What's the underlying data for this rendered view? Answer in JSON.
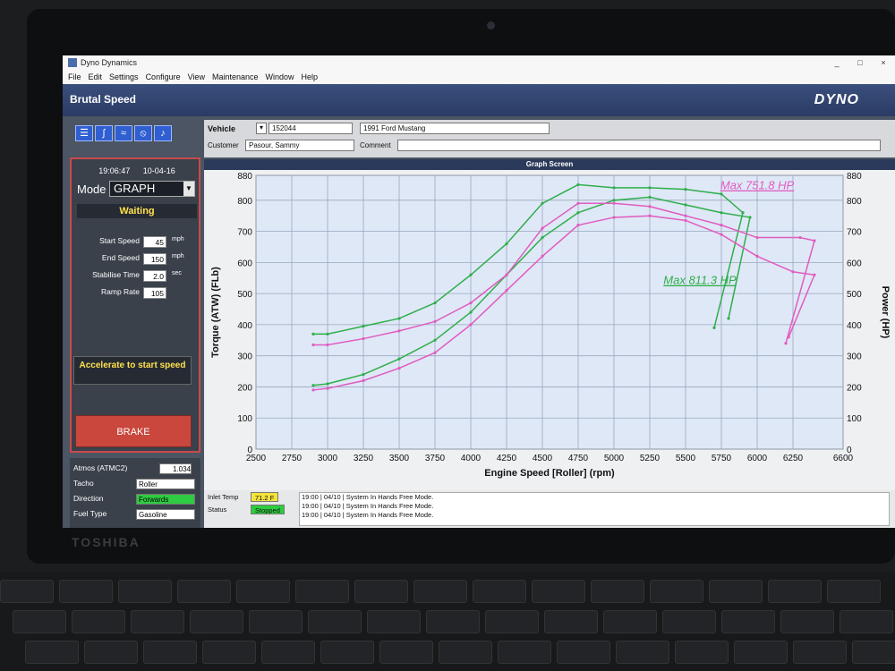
{
  "window": {
    "app_title": "Dyno Dynamics",
    "menu": [
      "File",
      "Edit",
      "Settings",
      "Configure",
      "View",
      "Maintenance",
      "Window",
      "Help"
    ],
    "controls": [
      "_",
      "□",
      "×"
    ]
  },
  "header": {
    "title": "Brutal Speed",
    "logo": "DYNO"
  },
  "toolbar": {
    "icons": [
      "list-icon",
      "curve-icon",
      "wave-icon",
      "no-icon",
      "bell-icon"
    ]
  },
  "vehicle": {
    "vehicle_label": "Vehicle",
    "vehicle_id": "152044",
    "vehicle_name": "1991 Ford Mustang",
    "customer_label": "Customer",
    "customer": "Pasour, Sammy",
    "comment_label": "Comment"
  },
  "left": {
    "time": "19:06:47",
    "date": "10-04-16",
    "mode_label": "Mode",
    "mode_value": "GRAPH",
    "status": "Waiting",
    "params": [
      {
        "label": "Start Speed",
        "value": "45",
        "unit": "mph"
      },
      {
        "label": "End Speed",
        "value": "150",
        "unit": "mph"
      },
      {
        "label": "Stabilise Time",
        "value": "2.0",
        "unit": "sec"
      },
      {
        "label": "Ramp Rate",
        "value": "105",
        "unit": ""
      }
    ],
    "accelerate": "Accelerate to start speed",
    "brake": "BRAKE"
  },
  "settings": {
    "atmos_label": "Atmos (ATMC2)",
    "atmos_value": "1.034",
    "tacho_label": "Tacho",
    "tacho_value": "Roller",
    "direction_label": "Direction",
    "direction_value": "Forwards",
    "fuel_label": "Fuel Type",
    "fuel_value": "Gasoline"
  },
  "graph": {
    "window_title": "Graph Screen"
  },
  "status": {
    "inlet_label": "Inlet Temp",
    "inlet_value": "71.2 F",
    "status_label": "Status",
    "status_value": "Stopped",
    "log": [
      "19:00 | 04/10 | System In Hands Free Mode.",
      "19:00 | 04/10 | System In Hands Free Mode.",
      "19:00 | 04/10 | System In Hands Free Mode."
    ]
  },
  "colors": {
    "green": "#2fae4a",
    "pink": "#e05cc0",
    "plot_bg": "#dfe8f7"
  },
  "chart_data": {
    "type": "line",
    "xlabel": "Engine Speed [Roller] (rpm)",
    "ylabel": "Torque (ATW) (FLb)",
    "y2label": "Power (HP)",
    "xlim": [
      2500,
      6600
    ],
    "ylim": [
      0,
      880
    ],
    "y2lim": [
      0,
      880
    ],
    "xticks": [
      2500,
      2750,
      3000,
      3250,
      3500,
      3750,
      4000,
      4250,
      4500,
      4750,
      5000,
      5250,
      5500,
      5750,
      6000,
      6250,
      6600
    ],
    "yticks": [
      0,
      100,
      200,
      300,
      400,
      500,
      600,
      700,
      800,
      880
    ],
    "y2ticks": [
      0,
      100,
      200,
      300,
      400,
      500,
      600,
      700,
      800,
      880
    ],
    "annotations": [
      {
        "text": "Max 751.8 HP",
        "color": "pink",
        "x": 6000,
        "y": 835
      },
      {
        "text": "Max 811.3 HP",
        "color": "green",
        "x": 5600,
        "y": 530
      }
    ],
    "series": [
      {
        "color": "green",
        "values": [
          [
            2900,
            370
          ],
          [
            3000,
            370
          ],
          [
            3250,
            395
          ],
          [
            3500,
            420
          ],
          [
            3750,
            470
          ],
          [
            4000,
            560
          ],
          [
            4250,
            660
          ],
          [
            4500,
            790
          ],
          [
            4750,
            850
          ],
          [
            5000,
            840
          ],
          [
            5250,
            840
          ],
          [
            5500,
            835
          ],
          [
            5750,
            820
          ],
          [
            5900,
            760
          ],
          [
            5700,
            390
          ]
        ]
      },
      {
        "color": "green",
        "values": [
          [
            2900,
            205
          ],
          [
            3000,
            210
          ],
          [
            3250,
            240
          ],
          [
            3500,
            290
          ],
          [
            3750,
            350
          ],
          [
            4000,
            440
          ],
          [
            4250,
            560
          ],
          [
            4500,
            680
          ],
          [
            4750,
            760
          ],
          [
            5000,
            800
          ],
          [
            5250,
            810
          ],
          [
            5500,
            785
          ],
          [
            5750,
            760
          ],
          [
            5950,
            745
          ],
          [
            5800,
            420
          ]
        ]
      },
      {
        "color": "pink",
        "values": [
          [
            2900,
            335
          ],
          [
            3000,
            335
          ],
          [
            3250,
            355
          ],
          [
            3500,
            380
          ],
          [
            3750,
            410
          ],
          [
            4000,
            470
          ],
          [
            4250,
            560
          ],
          [
            4500,
            710
          ],
          [
            4750,
            790
          ],
          [
            5000,
            790
          ],
          [
            5250,
            780
          ],
          [
            5500,
            750
          ],
          [
            5750,
            720
          ],
          [
            6000,
            680
          ],
          [
            6300,
            680
          ],
          [
            6400,
            670
          ],
          [
            6200,
            340
          ]
        ]
      },
      {
        "color": "pink",
        "values": [
          [
            2900,
            190
          ],
          [
            3000,
            195
          ],
          [
            3250,
            220
          ],
          [
            3500,
            260
          ],
          [
            3750,
            310
          ],
          [
            4000,
            400
          ],
          [
            4250,
            510
          ],
          [
            4500,
            620
          ],
          [
            4750,
            720
          ],
          [
            5000,
            745
          ],
          [
            5250,
            750
          ],
          [
            5500,
            735
          ],
          [
            5750,
            690
          ],
          [
            6000,
            620
          ],
          [
            6250,
            570
          ],
          [
            6400,
            560
          ],
          [
            6220,
            360
          ]
        ]
      }
    ]
  }
}
